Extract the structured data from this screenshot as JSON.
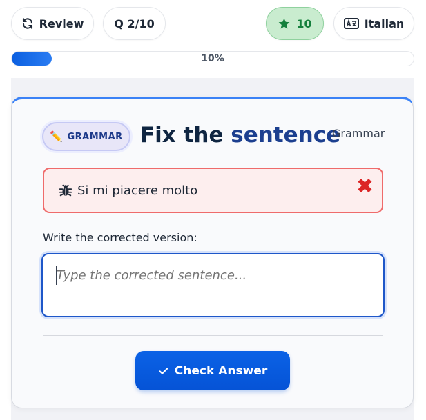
{
  "topbar": {
    "review_label": "Review",
    "question_counter": "Q 2/10",
    "stars_count": "10",
    "language_label": "Italian"
  },
  "progress": {
    "percent": 10,
    "label": "10%"
  },
  "card": {
    "badge_label": "GRAMMAR",
    "title_part1": "Fix the ",
    "title_part2": "sentence",
    "category": "Grammar",
    "erroneous_sentence": "Si mi piacere molto",
    "field_label": "Write the corrected version:",
    "input_placeholder": "Type the corrected sentence...",
    "input_value": "",
    "check_button_label": "Check Answer"
  },
  "colors": {
    "accent": "#0553d6",
    "stars_bg": "#c9eccf",
    "error": "#dc2626"
  },
  "icons": {
    "review": "refresh-icon",
    "stars": "star-icon",
    "language": "language-icon",
    "badge": "pencil-icon",
    "error": "bug-icon",
    "wrong": "close-icon",
    "check": "check-icon"
  }
}
